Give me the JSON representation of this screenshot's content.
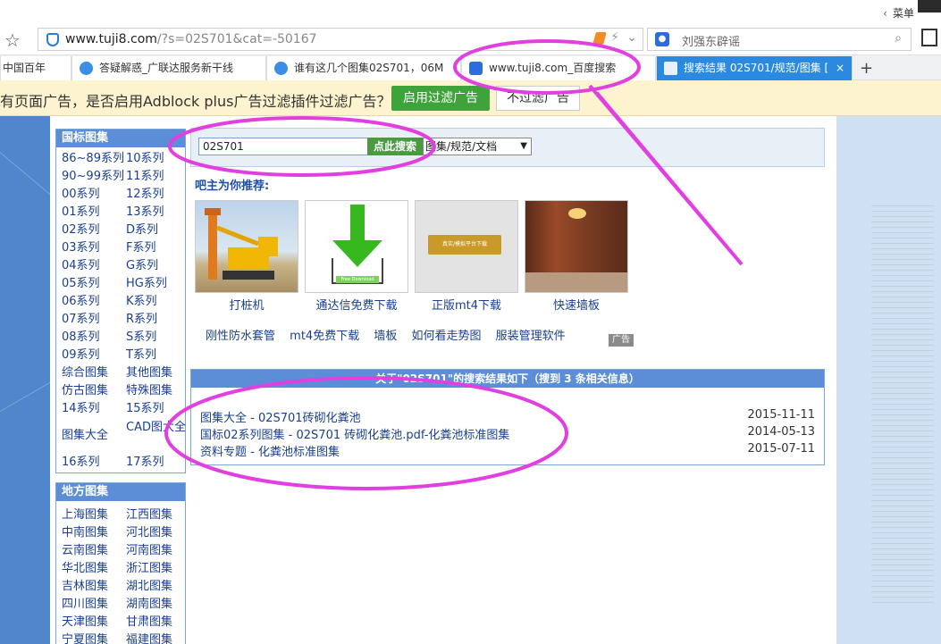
{
  "browser": {
    "menu_label": "菜单",
    "url_host": "www.tuji8.com",
    "url_path": "/?s=02S701&cat=-50167",
    "search_engine_text": "刘强东辟谣",
    "tabs": [
      {
        "label": "中国百年"
      },
      {
        "label": "答疑解惑_广联达服务新干线"
      },
      {
        "label": "谁有这几个图集02S701，06M"
      },
      {
        "label": "www.tuji8.com_百度搜索"
      },
      {
        "label": "搜索结果 02S701/规范/图集 [",
        "close": "×"
      }
    ],
    "new_tab": "+",
    "adblock_message": "有页面广告，是否启用Adblock plus广告过滤插件过滤广告？",
    "adblock_enable": "启用过滤广告",
    "adblock_disable": "不过滤广告"
  },
  "sidebar": {
    "national": {
      "title": "国标图集",
      "items": [
        "86~89系列",
        "10系列",
        "90~99系列",
        "11系列",
        "00系列",
        "12系列",
        "01系列",
        "13系列",
        "02系列",
        "D系列",
        "03系列",
        "F系列",
        "04系列",
        "G系列",
        "05系列",
        "HG系列",
        "06系列",
        "K系列",
        "07系列",
        "R系列",
        "08系列",
        "S系列",
        "09系列",
        "T系列",
        "综合图集",
        "其他图集",
        "仿古图集",
        "特殊图集",
        "14系列",
        "15系列",
        "图集大全",
        "CAD图大全",
        "16系列",
        "17系列"
      ]
    },
    "local": {
      "title": "地方图集",
      "items": [
        "上海图集",
        "江西图集",
        "中南图集",
        "河北图集",
        "云南图集",
        "河南图集",
        "华北图集",
        "浙江图集",
        "吉林图集",
        "湖北图集",
        "四川图集",
        "湖南图集",
        "天津图集",
        "甘肃图集",
        "宁夏图集",
        "福建图集"
      ]
    }
  },
  "search": {
    "query": "02S701",
    "button": "点此搜索",
    "category": "图集/规范/文档"
  },
  "recommend": {
    "title": "吧主为你推荐:",
    "items": [
      {
        "label": "打桩机"
      },
      {
        "label": "通达信免费下载",
        "thumb_text": "Free Download"
      },
      {
        "label": "正版mt4下载",
        "thumb_text": "真实/模拟平台下载"
      },
      {
        "label": "快速墙板"
      }
    ],
    "links": [
      "刚性防水套管",
      "mt4免费下载",
      "墙板",
      "如何看走势图",
      "服装管理软件"
    ],
    "ad_badge": "广告"
  },
  "results": {
    "header": "关于\"02S701\"的搜索结果如下（搜到 3 条相关信息）",
    "items": [
      {
        "title": "图集大全 - 02S701砖砌化粪池",
        "date": "2015-11-11"
      },
      {
        "title": "国标02系列图集 - 02S701 砖砌化粪池.pdf-化粪池标准图集",
        "date": "2014-05-13"
      },
      {
        "title": "资料专题 - 化粪池标准图集",
        "date": "2015-07-11"
      }
    ]
  },
  "colors": {
    "accent": "#5b8ed6",
    "link": "#1a3f8f",
    "annotation": "#e23fe0",
    "page_bg": "#4f86cc"
  }
}
